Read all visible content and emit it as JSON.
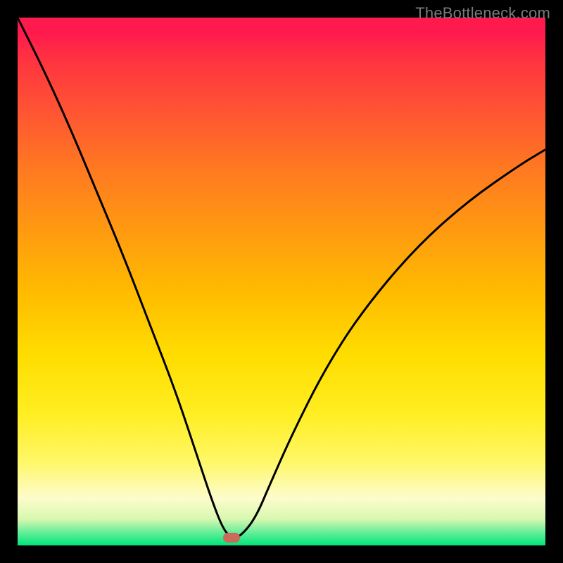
{
  "watermark": "TheBottleneck.com",
  "chart_data": {
    "type": "line",
    "title": "",
    "xlabel": "",
    "ylabel": "",
    "xlim": [
      0,
      100
    ],
    "ylim": [
      0,
      100
    ],
    "grid": false,
    "legend": false,
    "marker": {
      "x": 40.5,
      "y": 1.5
    },
    "series": [
      {
        "name": "bottleneck-curve",
        "x": [
          0,
          5,
          10,
          15,
          20,
          25,
          30,
          34,
          37,
          39,
          40.5,
          42,
          45,
          48,
          52,
          58,
          65,
          75,
          85,
          95,
          100
        ],
        "values": [
          100,
          90,
          79,
          67,
          55,
          42,
          29,
          17,
          8,
          3,
          1.5,
          1.5,
          5,
          12,
          21,
          33,
          44,
          56,
          65,
          72,
          75
        ]
      }
    ],
    "background_gradient": {
      "top_color": "#ff1a4d",
      "mid_color": "#ffdd00",
      "bottom_color": "#00e57a"
    }
  }
}
